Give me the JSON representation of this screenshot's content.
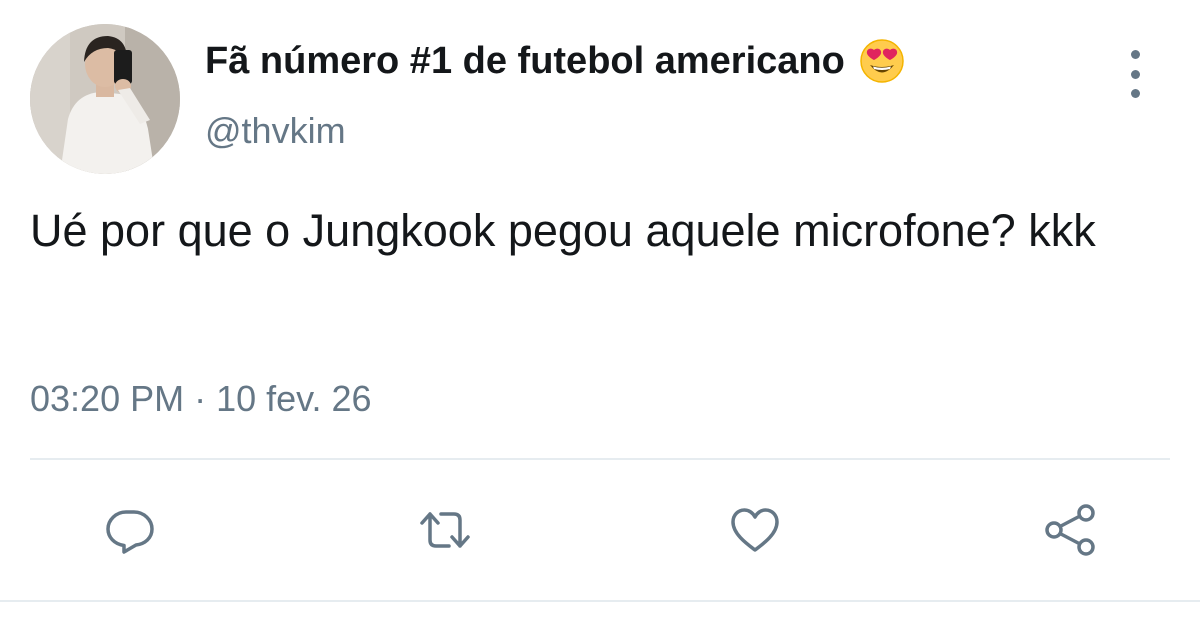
{
  "tweet": {
    "display_name": "Fã número #1 de futebol americano",
    "name_emoji": "heart-eyes-emoji",
    "handle": "@thvkim",
    "text": "Ué por que o Jungkook pegou aquele microfone? kkk",
    "time": "03:20 PM",
    "separator": " · ",
    "date": "10 fev. 26"
  },
  "actions": [
    {
      "icon": "reply-icon"
    },
    {
      "icon": "retweet-icon"
    },
    {
      "icon": "like-icon"
    },
    {
      "icon": "share-icon"
    }
  ],
  "colors": {
    "text": "#14171a",
    "secondary": "#657786",
    "divider": "#e6ecf0"
  }
}
